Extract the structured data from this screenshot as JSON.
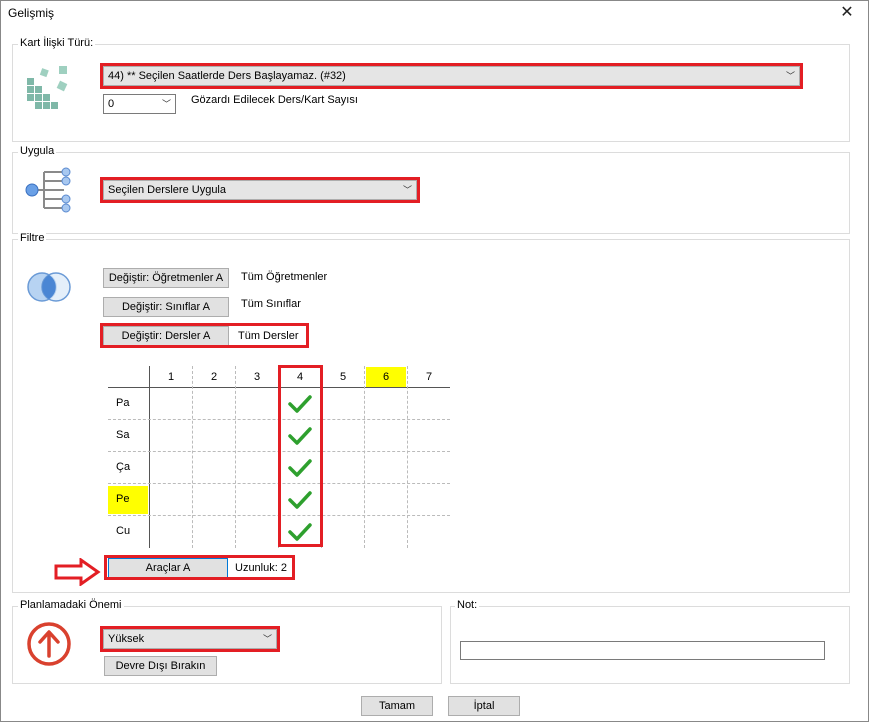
{
  "window": {
    "title": "Gelişmiş",
    "close_symbol": "✕"
  },
  "card_relation": {
    "legend": "Kart İlişki Türü:",
    "selected": "44) ** Seçilen Saatlerde Ders Başlayamaz. (#32)",
    "ignore_count": "0",
    "ignore_label": "Gözardı Edilecek Ders/Kart Sayısı"
  },
  "apply": {
    "legend": "Uygula",
    "selected": "Seçilen Derslere Uygula"
  },
  "filter": {
    "legend": "Filtre",
    "rows": [
      {
        "button": "Değiştir: Öğretmenler A",
        "value": "Tüm Öğretmenler"
      },
      {
        "button": "Değiştir: Sınıflar A",
        "value": "Tüm Sınıflar"
      },
      {
        "button": "Değiştir: Dersler A",
        "value": "Tüm Dersler"
      }
    ]
  },
  "grid": {
    "columns": [
      "1",
      "2",
      "3",
      "4",
      "5",
      "6",
      "7"
    ],
    "rows": [
      "Pa",
      "Sa",
      "Ça",
      "Pe",
      "Cu"
    ],
    "highlight_color": "#ffff00",
    "highlighted_column": "6",
    "highlighted_row": "Pe",
    "checked_column": "4",
    "check_color": "#2ea02e"
  },
  "tools": {
    "button": "Araçlar A",
    "length_label": "Uzunluk: 2"
  },
  "importance": {
    "legend": "Planlamadaki Önemi",
    "selected": "Yüksek",
    "disable_button": "Devre Dışı Bırakın"
  },
  "note": {
    "legend": "Not:",
    "value": ""
  },
  "footer": {
    "ok": "Tamam",
    "cancel": "İptal"
  },
  "annotation_color": "#e31e24"
}
